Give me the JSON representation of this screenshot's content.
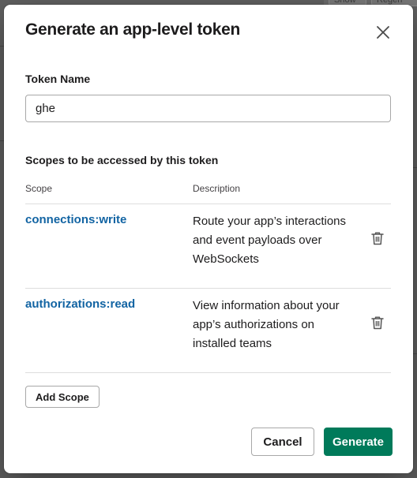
{
  "background": {
    "chips": [
      "Show",
      "Regen"
    ]
  },
  "modal": {
    "title": "Generate an app-level token",
    "close_icon": "close-icon"
  },
  "token_field": {
    "label": "Token Name",
    "value": "ghe"
  },
  "scopes": {
    "heading": "Scopes to be accessed by this token",
    "columns": {
      "scope": "Scope",
      "description": "Description"
    },
    "rows": [
      {
        "scope": "connections:write",
        "description": "Route your app’s interactions and event payloads over WebSockets",
        "icon": "trash-icon"
      },
      {
        "scope": "authorizations:read",
        "description": "View information about your app’s authorizations on installed teams",
        "icon": "trash-icon"
      }
    ]
  },
  "buttons": {
    "add_scope": "Add Scope",
    "cancel": "Cancel",
    "generate": "Generate"
  },
  "colors": {
    "link": "#1264a3",
    "primary": "#007a5a",
    "overlay": "#5f5f5f"
  }
}
